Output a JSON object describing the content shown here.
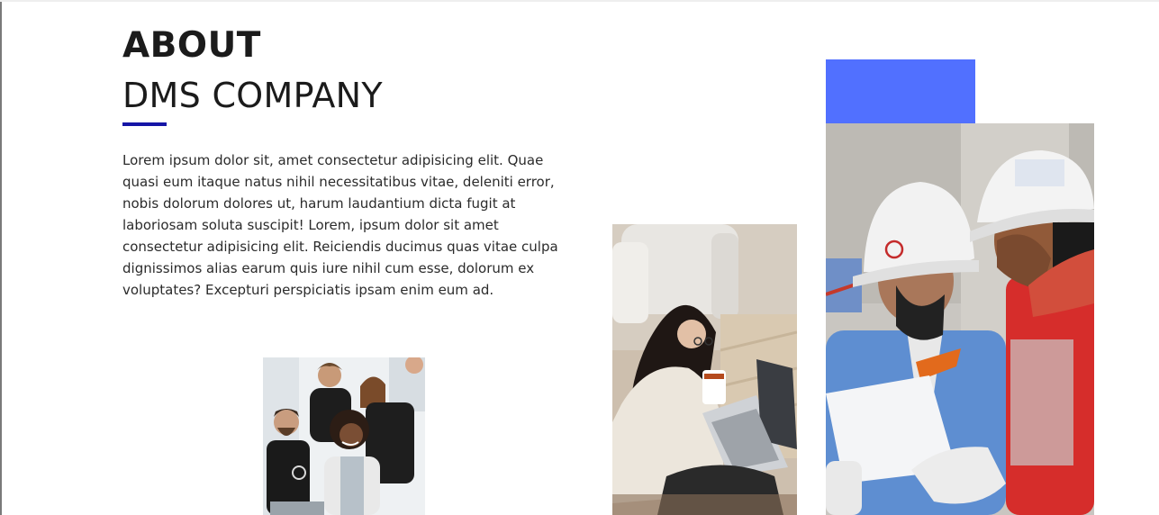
{
  "about": {
    "title_line1": "ABOUT",
    "title_line2": "DMS COMPANY",
    "description": "Lorem ipsum dolor sit, amet consectetur adipisicing elit. Quae quasi eum itaque natus nihil necessitatibus vitae, deleniti error, nobis dolorum dolores ut, harum laudantium dicta fugit at laboriosam soluta suscipit! Lorem, ipsum dolor sit amet consectetur adipisicing elit. Reiciendis ducimus quas vitae culpa dignissimos alias earum quis iure nihil cum esse, dolorum ex voluptates? Excepturi perspiciatis ipsam enim eum ad."
  },
  "colors": {
    "accent": "#1515a6",
    "block": "#5170ff",
    "text": "#1b1b1b"
  }
}
